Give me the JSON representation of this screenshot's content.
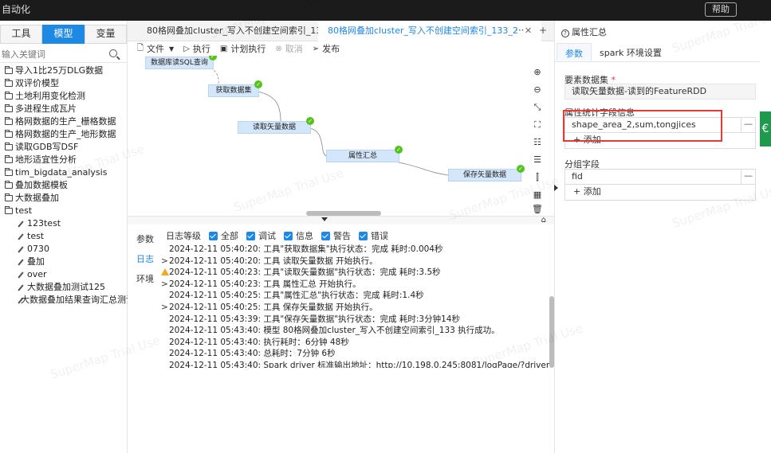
{
  "topbar": {
    "title": "自动化",
    "help": "帮助"
  },
  "left": {
    "tabs": [
      "工具",
      "模型",
      "变量"
    ],
    "search_placeholder": "输入关键词",
    "folders": [
      "导入1比25万DLG数据",
      "双评价模型",
      "土地利用变化检测",
      "多进程生成瓦片",
      "格网数据的生产_栅格数据",
      "格网数据的生产_地形数据",
      "读取GDB写DSF",
      "地形适宜性分析",
      "tim_bigdata_analysis",
      "叠加数据模板",
      "大数据叠加",
      "test"
    ],
    "children": [
      "123test",
      "test",
      "0730",
      "叠加",
      "over",
      "大数据叠加测试125",
      "大数据叠加结果查询汇总测试"
    ]
  },
  "doc_tabs": [
    "80格网叠加cluster_写入不创建空间索引_133",
    "80格网叠加cluster_写入不创建空间索引_133_2"
  ],
  "toolbar": {
    "file": "文件",
    "run": "执行",
    "schedule": "计划执行",
    "cancel": "取消",
    "publish": "发布"
  },
  "nodes": [
    "数据库读SQL查询",
    "获取数据集",
    "读取矢量数据",
    "属性汇总",
    "保存矢量数据"
  ],
  "log": {
    "side_tabs": [
      "参数",
      "日志",
      "环境"
    ],
    "filter_label": "日志等级",
    "filters": [
      "全部",
      "调试",
      "信息",
      "警告",
      "错误"
    ],
    "lines": [
      "2024-12-11 05:40:20:  工具\"获取数据集\"执行状态：完成   耗时:0.004秒",
      "2024-12-11 05:40:20:  工具 读取矢量数据 开始执行。",
      "2024-12-11 05:40:23:  工具\"读取矢量数据\"执行状态：完成   耗时:3.5秒",
      "2024-12-11 05:40:23:  工具 属性汇总 开始执行。",
      "2024-12-11 05:40:25:  工具\"属性汇总\"执行状态：完成   耗时:1.4秒",
      "2024-12-11 05:40:25:  工具 保存矢量数据 开始执行。",
      "2024-12-11 05:43:39:  工具\"保存矢量数据\"执行状态：完成   耗时:3分钟14秒",
      "2024-12-11 05:43:40:  模型 80格网叠加cluster_写入不创建空间索引_133 执行成功。",
      "2024-12-11 05:43:40:  执行耗时：6分钟 48秒",
      "2024-12-11 05:43:40:  总耗时：7分钟 6秒",
      "2024-12-11 05:43:40:  Spark driver 标准输出地址：http://10.198.0.245:8081/logPage/?driverId=driver-"
    ]
  },
  "right": {
    "header": "属性汇总",
    "tabs": [
      "参数",
      "spark 环境设置"
    ],
    "source_label": "要素数据集",
    "source_value": "读取矢量数据-读到的FeatureRDD",
    "stats_label": "属性统计字段信息",
    "stats_value": "shape_area_2,sum,tongjices",
    "group_label": "分组字段",
    "group_value": "fid",
    "add_label": "+ 添加",
    "minus": "—"
  },
  "watermark": "SuperMap Trial Use"
}
